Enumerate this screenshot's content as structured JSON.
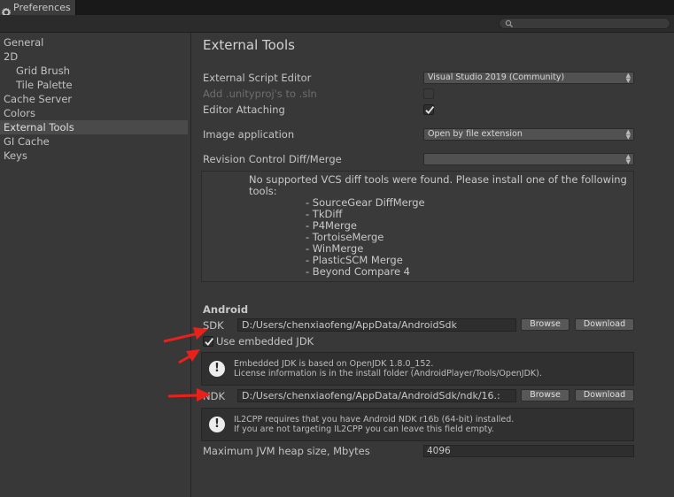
{
  "window": {
    "tab_title": "Preferences"
  },
  "search": {
    "placeholder": ""
  },
  "sidebar": {
    "items": [
      {
        "label": "General"
      },
      {
        "label": "2D"
      },
      {
        "label": "Grid Brush"
      },
      {
        "label": "Tile Palette"
      },
      {
        "label": "Cache Server"
      },
      {
        "label": "Colors"
      },
      {
        "label": "External Tools"
      },
      {
        "label": "GI Cache"
      },
      {
        "label": "Keys"
      }
    ]
  },
  "main": {
    "title": "External Tools",
    "external_script_editor": {
      "label": "External Script Editor",
      "value": "Visual Studio 2019 (Community)"
    },
    "add_unityproj": {
      "label": "Add .unityproj's to .sln",
      "checked": false,
      "disabled": true
    },
    "editor_attaching": {
      "label": "Editor Attaching",
      "checked": true
    },
    "image_application": {
      "label": "Image application",
      "value": "Open by file extension"
    },
    "revision_control": {
      "label": "Revision Control Diff/Merge",
      "value": ""
    },
    "vcs_message": {
      "line1": "No supported VCS diff tools were found. Please install one of the following",
      "line2": "tools:",
      "tools": [
        "- SourceGear DiffMerge",
        "- TkDiff",
        "- P4Merge",
        "- TortoiseMerge",
        "- WinMerge",
        "- PlasticSCM Merge",
        "- Beyond Compare 4"
      ]
    }
  },
  "android": {
    "section_title": "Android",
    "sdk": {
      "label": "SDK",
      "path": "D:/Users/chenxiaofeng/AppData/AndroidSdk",
      "browse": "Browse",
      "download": "Download"
    },
    "use_embedded_jdk": {
      "label": "Use embedded JDK",
      "checked": true
    },
    "jdk_help": {
      "line1": "Embedded JDK is based on OpenJDK 1.8.0_152.",
      "line2": "License information is in the install folder (AndroidPlayer/Tools/OpenJDK)."
    },
    "ndk": {
      "label": "NDK",
      "path": "D:/Users/chenxiaofeng/AppData/AndroidSdk/ndk/16.:",
      "browse": "Browse",
      "download": "Download"
    },
    "ndk_help": {
      "line1": "IL2CPP requires that you have Android NDK r16b (64-bit) installed.",
      "line2": "If you are not targeting IL2CPP you can leave this field empty."
    },
    "jvm_heap": {
      "label": "Maximum JVM heap size, Mbytes",
      "value": "4096"
    }
  },
  "colors": {
    "annotation_arrow": "#e8221a",
    "background": "#383838",
    "selection": "#4a4a4a"
  }
}
